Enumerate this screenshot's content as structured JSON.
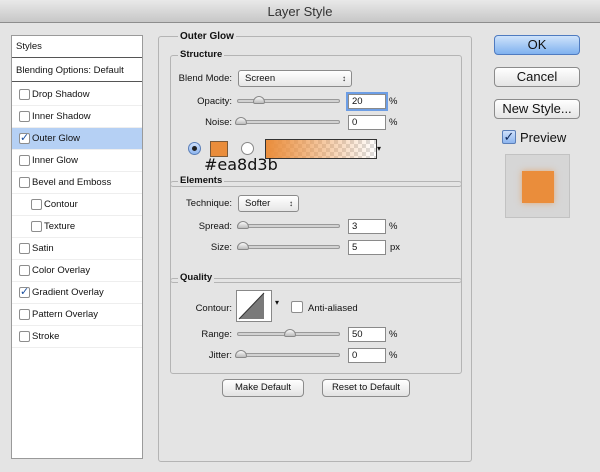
{
  "window": {
    "title": "Layer Style"
  },
  "styles_list": {
    "header": "Styles",
    "blending": "Blending Options: Default",
    "items": [
      {
        "label": "Drop Shadow",
        "checked": false
      },
      {
        "label": "Inner Shadow",
        "checked": false
      },
      {
        "label": "Outer Glow",
        "checked": true
      },
      {
        "label": "Inner Glow",
        "checked": false
      },
      {
        "label": "Bevel and Emboss",
        "checked": false
      },
      {
        "label": "Contour",
        "checked": false
      },
      {
        "label": "Texture",
        "checked": false
      },
      {
        "label": "Satin",
        "checked": false
      },
      {
        "label": "Color Overlay",
        "checked": false
      },
      {
        "label": "Gradient Overlay",
        "checked": true
      },
      {
        "label": "Pattern Overlay",
        "checked": false
      },
      {
        "label": "Stroke",
        "checked": false
      }
    ],
    "selected": "Outer Glow",
    "check_glyph": "✓"
  },
  "outer_glow": {
    "title": "Outer Glow",
    "structure": {
      "title": "Structure",
      "blend_mode_label": "Blend Mode:",
      "blend_mode_value": "Screen",
      "opacity_label": "Opacity:",
      "opacity_value": "20",
      "opacity_unit": "%",
      "noise_label": "Noise:",
      "noise_value": "0",
      "noise_unit": "%",
      "glow_color": "#ea8d3b",
      "glow_color_text": "#ea8d3b"
    },
    "elements": {
      "title": "Elements",
      "technique_label": "Technique:",
      "technique_value": "Softer",
      "spread_label": "Spread:",
      "spread_value": "3",
      "spread_unit": "%",
      "size_label": "Size:",
      "size_value": "5",
      "size_unit": "px"
    },
    "quality": {
      "title": "Quality",
      "contour_label": "Contour:",
      "anti_aliased_label": "Anti-aliased",
      "range_label": "Range:",
      "range_value": "50",
      "range_unit": "%",
      "jitter_label": "Jitter:",
      "jitter_value": "0",
      "jitter_unit": "%"
    },
    "make_default": "Make Default",
    "reset_default": "Reset to Default"
  },
  "actions": {
    "ok": "OK",
    "cancel": "Cancel",
    "new_style": "New Style...",
    "preview": "Preview",
    "preview_checked": true
  },
  "icons": [
    "check-icon",
    "chevron-updown-icon",
    "chevron-down-icon",
    "contour-curve-icon"
  ],
  "colors": {
    "selection": "#b5d0f4",
    "accent": "#7fb1ef",
    "glow": "#ea8d3b"
  }
}
